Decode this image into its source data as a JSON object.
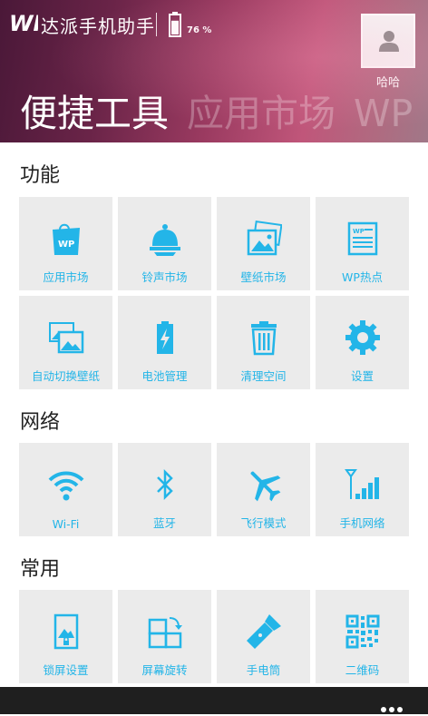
{
  "header": {
    "app_logo_text": "WP",
    "app_title": "达派手机助手",
    "battery_percent": "76 %",
    "battery_level": 0.76,
    "username": "哈哈"
  },
  "pivot": [
    "便捷工具",
    "应用市场",
    "WP"
  ],
  "sections": [
    {
      "title": "功能",
      "tiles": [
        {
          "label": "应用市场",
          "icon": "store-bag-icon"
        },
        {
          "label": "铃声市场",
          "icon": "bell-icon"
        },
        {
          "label": "壁纸市场",
          "icon": "wallpaper-icon"
        },
        {
          "label": "WP热点",
          "icon": "news-icon"
        },
        {
          "label": "自动切换壁纸",
          "icon": "switch-wallpaper-icon"
        },
        {
          "label": "电池管理",
          "icon": "battery-charge-icon"
        },
        {
          "label": "清理空间",
          "icon": "trash-icon"
        },
        {
          "label": "设置",
          "icon": "gear-icon"
        }
      ]
    },
    {
      "title": "网络",
      "tiles": [
        {
          "label": "Wi-Fi",
          "icon": "wifi-icon"
        },
        {
          "label": "蓝牙",
          "icon": "bluetooth-icon"
        },
        {
          "label": "飞行模式",
          "icon": "airplane-icon"
        },
        {
          "label": "手机网络",
          "icon": "signal-icon"
        }
      ]
    },
    {
      "title": "常用",
      "tiles": [
        {
          "label": "锁屏设置",
          "icon": "lockscreen-icon"
        },
        {
          "label": "屏幕旋转",
          "icon": "rotate-screen-icon"
        },
        {
          "label": "手电筒",
          "icon": "flashlight-icon"
        },
        {
          "label": "二维码",
          "icon": "qrcode-icon"
        }
      ]
    }
  ],
  "colors": {
    "accent": "#23b5e8",
    "tile_bg": "#ebebeb",
    "appbar_bg": "#1f1f1f"
  }
}
